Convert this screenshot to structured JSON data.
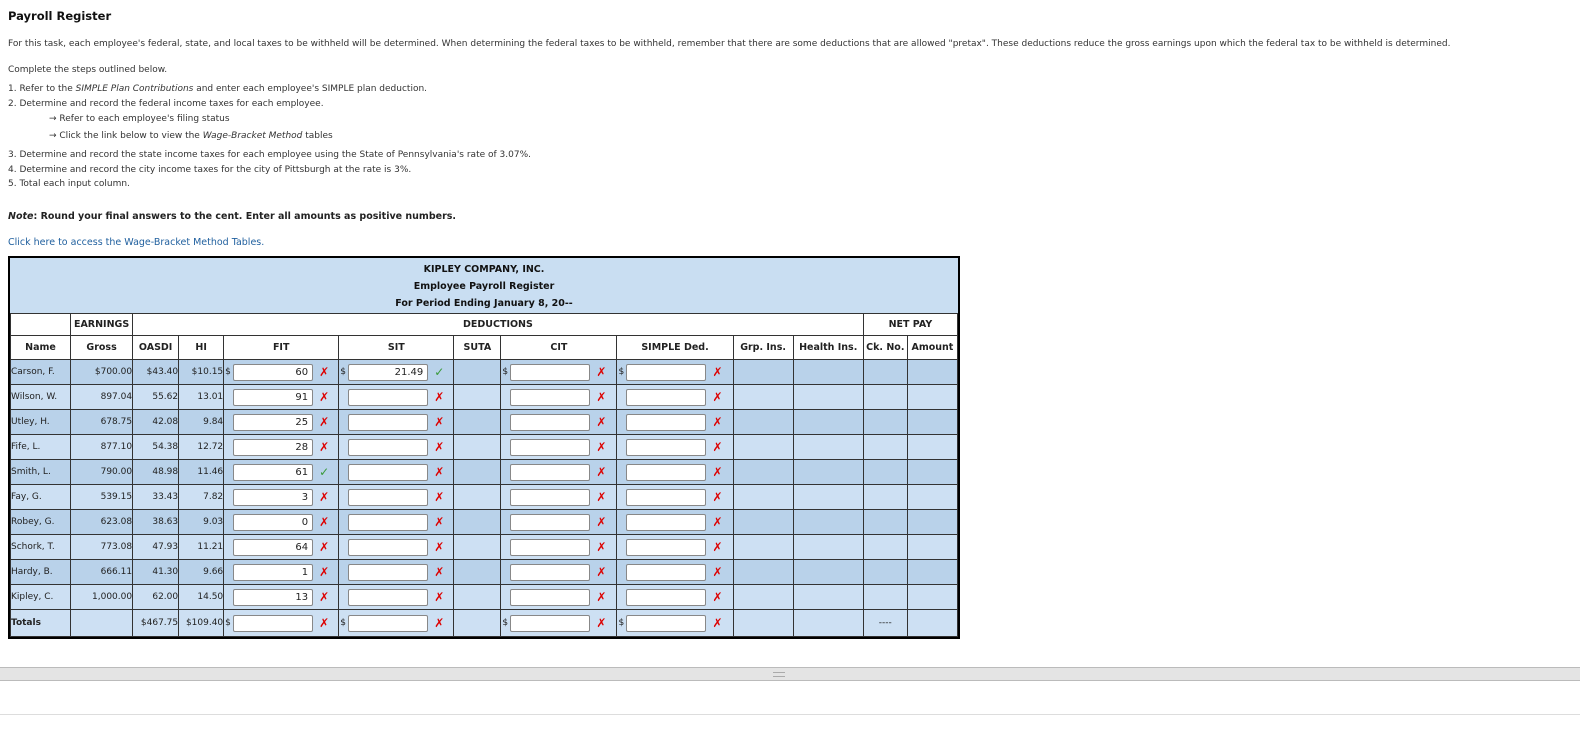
{
  "page": {
    "title": "Payroll Register",
    "intro": "For this task, each employee's federal, state, and local taxes to be withheld will be determined. When determining the federal taxes to be withheld, remember that there are some deductions that are allowed \"pretax\". These deductions reduce the gross earnings upon which the federal tax to be withheld is determined.",
    "steps_intro": "Complete the steps outlined below.",
    "step1_a": "1. Refer to the ",
    "step1_b": "SIMPLE Plan Contributions",
    "step1_c": " and enter each employee's SIMPLE plan deduction.",
    "step2": "2. Determine and record the federal income taxes for each employee.",
    "step2_sub1": "→ Refer to each employee's filing status",
    "step2_sub2_a": "→ Click the link below to view the ",
    "step2_sub2_b": "Wage-Bracket Method",
    "step2_sub2_c": " tables",
    "step3": "3. Determine and record the state income taxes for each employee using the State of Pennsylvania's rate of 3.07%.",
    "step4": "4. Determine and record the city income taxes for the city of Pittsburgh at the rate is 3%.",
    "step5": "5. Total each input column.",
    "note_label": "Note",
    "note_text": ": Round your final answers to the cent. Enter all amounts as positive numbers.",
    "link": "Click here to access the Wage-Bracket Method Tables."
  },
  "register": {
    "company": "KIPLEY COMPANY, INC.",
    "subtitle": "Employee Payroll Register",
    "period": "For Period Ending January 8, 20--",
    "group_headers": {
      "earnings": "EARNINGS",
      "deductions": "DEDUCTIONS",
      "net_pay": "NET PAY"
    },
    "columns": {
      "name": "Name",
      "gross": "Gross",
      "oasdi": "OASDI",
      "hi": "HI",
      "fit": "FIT",
      "sit": "SIT",
      "suta": "SUTA",
      "cit": "CIT",
      "simple": "SIMPLE Ded.",
      "grp": "Grp. Ins.",
      "health": "Health Ins.",
      "ck": "Ck. No.",
      "amount": "Amount"
    },
    "currency": "$",
    "rows": [
      {
        "name": "Carson, F.",
        "gross": "$700.00",
        "oasdi": "$43.40",
        "hi": "$10.15",
        "fit": "60",
        "fit_mark": "x",
        "sit": "21.49",
        "sit_mark": "ok",
        "cit": "",
        "cit_mark": "x",
        "simple": "",
        "simple_mark": "x"
      },
      {
        "name": "Wilson, W.",
        "gross": "897.04",
        "oasdi": "55.62",
        "hi": "13.01",
        "fit": "91",
        "fit_mark": "x",
        "sit": "",
        "sit_mark": "x",
        "cit": "",
        "cit_mark": "x",
        "simple": "",
        "simple_mark": "x"
      },
      {
        "name": "Utley, H.",
        "gross": "678.75",
        "oasdi": "42.08",
        "hi": "9.84",
        "fit": "25",
        "fit_mark": "x",
        "sit": "",
        "sit_mark": "x",
        "cit": "",
        "cit_mark": "x",
        "simple": "",
        "simple_mark": "x"
      },
      {
        "name": "Fife, L.",
        "gross": "877.10",
        "oasdi": "54.38",
        "hi": "12.72",
        "fit": "28",
        "fit_mark": "x",
        "sit": "",
        "sit_mark": "x",
        "cit": "",
        "cit_mark": "x",
        "simple": "",
        "simple_mark": "x"
      },
      {
        "name": "Smith, L.",
        "gross": "790.00",
        "oasdi": "48.98",
        "hi": "11.46",
        "fit": "61",
        "fit_mark": "ok",
        "sit": "",
        "sit_mark": "x",
        "cit": "",
        "cit_mark": "x",
        "simple": "",
        "simple_mark": "x"
      },
      {
        "name": "Fay, G.",
        "gross": "539.15",
        "oasdi": "33.43",
        "hi": "7.82",
        "fit": "3",
        "fit_mark": "x",
        "sit": "",
        "sit_mark": "x",
        "cit": "",
        "cit_mark": "x",
        "simple": "",
        "simple_mark": "x"
      },
      {
        "name": "Robey, G.",
        "gross": "623.08",
        "oasdi": "38.63",
        "hi": "9.03",
        "fit": "0",
        "fit_mark": "x",
        "sit": "",
        "sit_mark": "x",
        "cit": "",
        "cit_mark": "x",
        "simple": "",
        "simple_mark": "x"
      },
      {
        "name": "Schork, T.",
        "gross": "773.08",
        "oasdi": "47.93",
        "hi": "11.21",
        "fit": "64",
        "fit_mark": "x",
        "sit": "",
        "sit_mark": "x",
        "cit": "",
        "cit_mark": "x",
        "simple": "",
        "simple_mark": "x"
      },
      {
        "name": "Hardy, B.",
        "gross": "666.11",
        "oasdi": "41.30",
        "hi": "9.66",
        "fit": "1",
        "fit_mark": "x",
        "sit": "",
        "sit_mark": "x",
        "cit": "",
        "cit_mark": "x",
        "simple": "",
        "simple_mark": "x"
      },
      {
        "name": "Kipley, C.",
        "gross": "1,000.00",
        "oasdi": "62.00",
        "hi": "14.50",
        "fit": "13",
        "fit_mark": "x",
        "sit": "",
        "sit_mark": "x",
        "cit": "",
        "cit_mark": "x",
        "simple": "",
        "simple_mark": "x"
      }
    ],
    "totals": {
      "label": "Totals",
      "oasdi": "$467.75",
      "hi": "$109.40",
      "fit": "",
      "fit_mark": "x",
      "sit": "",
      "sit_mark": "x",
      "cit": "",
      "cit_mark": "x",
      "simple": "",
      "simple_mark": "x",
      "ck": "----"
    },
    "mark_glyphs": {
      "x": "✗",
      "ok": "✓"
    }
  }
}
